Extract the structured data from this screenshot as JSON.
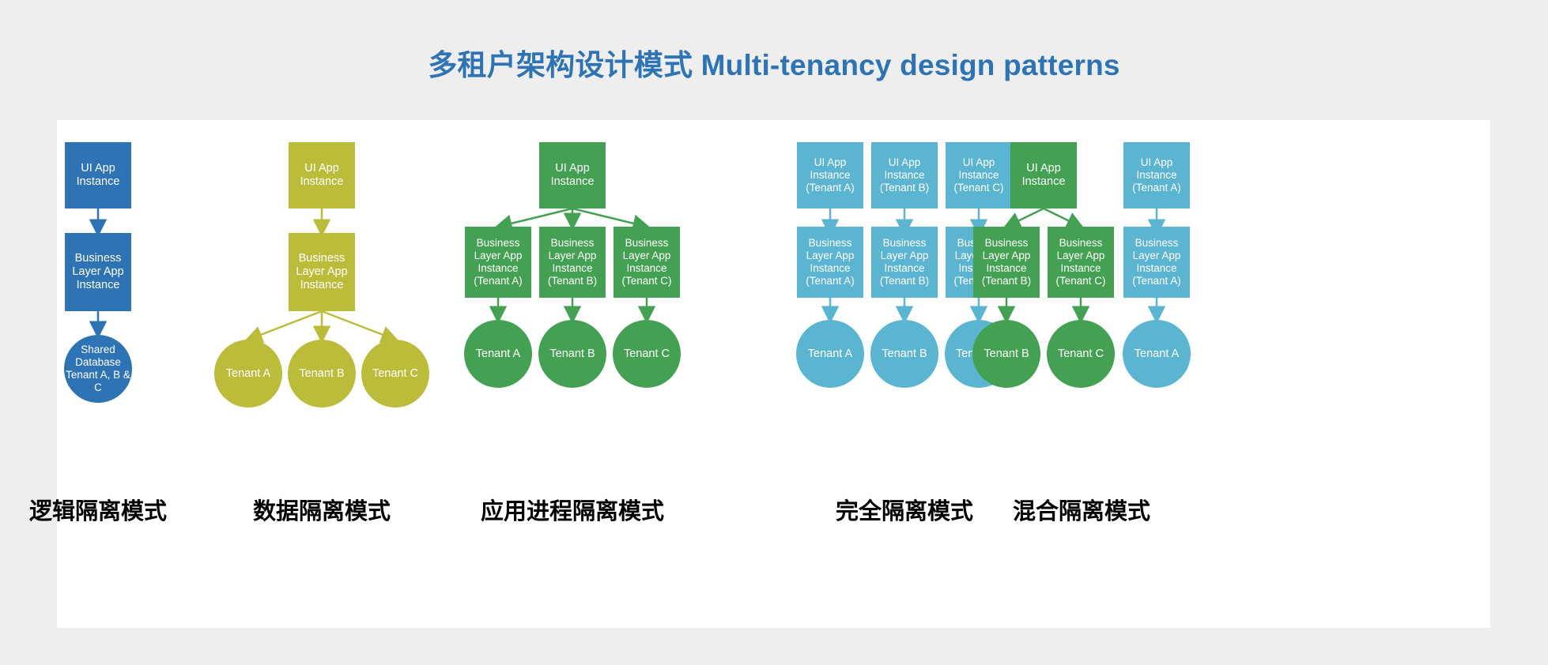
{
  "title": "多租户架构设计模式 Multi-tenancy design patterns",
  "colors": {
    "background": "#eeeeee",
    "card": "#ffffff",
    "title": "#2E74B5",
    "dark_blue": "#2E74B5",
    "olive": "#BABC3A",
    "green": "#44A053",
    "light_blue": "#5BB4D0",
    "caption": "#000000"
  },
  "labels": {
    "ui_app_instance": "UI App Instance",
    "business_layer_app_instance": "Business Layer App Instance",
    "ui_app_instance_a": "UI App Instance (Tenant A)",
    "ui_app_instance_b": "UI App Instance (Tenant B)",
    "ui_app_instance_c": "UI App Instance (Tenant C)",
    "business_a": "Business Layer App Instance (Tenant A)",
    "business_b": "Business Layer App Instance (Tenant B)",
    "business_c": "Business Layer App Instance (Tenant C)",
    "tenant_a": "Tenant A",
    "tenant_b": "Tenant B",
    "tenant_c": "Tenant C",
    "shared_database": "Shared Database Tenant A, B & C"
  },
  "columns": [
    {
      "id": "logical-isolation",
      "caption": "逻辑隔离模式",
      "color": "#2E74B5",
      "nodes": {
        "ui": "UI App Instance",
        "business": "Business Layer App Instance",
        "db": "Shared Database Tenant A, B & C"
      }
    },
    {
      "id": "data-isolation",
      "caption": "数据隔离模式",
      "color": "#BABC3A",
      "nodes": {
        "ui": "UI App Instance",
        "business": "Business Layer App Instance",
        "tenants": [
          "Tenant A",
          "Tenant B",
          "Tenant C"
        ]
      }
    },
    {
      "id": "app-process-isolation",
      "caption": "应用进程隔离模式",
      "color": "#44A053",
      "nodes": {
        "ui": "UI App Instance",
        "business": [
          "Business Layer App Instance (Tenant A)",
          "Business Layer App Instance (Tenant B)",
          "Business Layer App Instance (Tenant C)"
        ],
        "tenants": [
          "Tenant A",
          "Tenant B",
          "Tenant C"
        ]
      }
    },
    {
      "id": "full-isolation",
      "caption": "完全隔离模式",
      "color": "#5BB4D0",
      "nodes": {
        "ui": [
          "UI App Instance (Tenant A)",
          "UI App Instance (Tenant B)",
          "UI App Instance (Tenant C)"
        ],
        "business": [
          "Business Layer App Instance (Tenant A)",
          "Business Layer App Instance (Tenant B)",
          "Business Layer App Instance (Tenant C)"
        ],
        "tenants": [
          "Tenant A",
          "Tenant B",
          "Tenant C"
        ]
      }
    },
    {
      "id": "hybrid-isolation",
      "caption": "混合隔离模式",
      "colors": [
        "#44A053",
        "#5BB4D0"
      ],
      "nodes": {
        "ui_shared": "UI App Instance",
        "ui_dedicated": "UI App Instance (Tenant A)",
        "business": [
          "Business Layer App Instance (Tenant B)",
          "Business Layer App Instance (Tenant C)",
          "Business Layer App Instance (Tenant A)"
        ],
        "tenants": [
          "Tenant B",
          "Tenant C",
          "Tenant A"
        ]
      }
    }
  ]
}
